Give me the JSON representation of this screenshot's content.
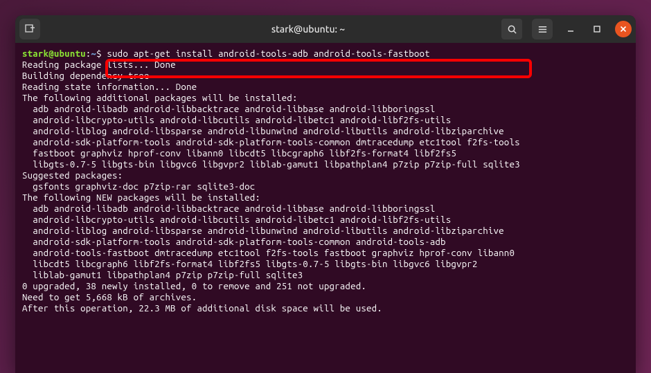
{
  "window": {
    "title": "stark@ubuntu: ~"
  },
  "prompt": {
    "userhost": "stark@ubuntu",
    "sep": ":",
    "path": "~",
    "dollar": "$",
    "command": "sudo apt-get install android-tools-adb android-tools-fastboot"
  },
  "output": {
    "l01": "Reading package lists... Done",
    "l02": "Building dependency tree",
    "l03": "Reading state information... Done",
    "l04": "The following additional packages will be installed:",
    "l05": "  adb android-libadb android-libbacktrace android-libbase android-libboringssl",
    "l06": "  android-libcrypto-utils android-libcutils android-libetc1 android-libf2fs-utils",
    "l07": "  android-liblog android-libsparse android-libunwind android-libutils android-libziparchive",
    "l08": "  android-sdk-platform-tools android-sdk-platform-tools-common dmtracedump etc1tool f2fs-tools",
    "l09": "  fastboot graphviz hprof-conv libann0 libcdt5 libcgraph6 libf2fs-format4 libf2fs5",
    "l10": "  libgts-0.7-5 libgts-bin libgvc6 libgvpr2 liblab-gamut1 libpathplan4 p7zip p7zip-full sqlite3",
    "l11": "Suggested packages:",
    "l12": "  gsfonts graphviz-doc p7zip-rar sqlite3-doc",
    "l13": "The following NEW packages will be installed:",
    "l14": "  adb android-libadb android-libbacktrace android-libbase android-libboringssl",
    "l15": "  android-libcrypto-utils android-libcutils android-libetc1 android-libf2fs-utils",
    "l16": "  android-liblog android-libsparse android-libunwind android-libutils android-libziparchive",
    "l17": "  android-sdk-platform-tools android-sdk-platform-tools-common android-tools-adb",
    "l18": "  android-tools-fastboot dmtracedump etc1tool f2fs-tools fastboot graphviz hprof-conv libann0",
    "l19": "  libcdt5 libcgraph6 libf2fs-format4 libf2fs5 libgts-0.7-5 libgts-bin libgvc6 libgvpr2",
    "l20": "  liblab-gamut1 libpathplan4 p7zip p7zip-full sqlite3",
    "l21": "0 upgraded, 38 newly installed, 0 to remove and 251 not upgraded.",
    "l22": "Need to get 5,668 kB of archives.",
    "l23": "After this operation, 22.3 MB of additional disk space will be used."
  }
}
